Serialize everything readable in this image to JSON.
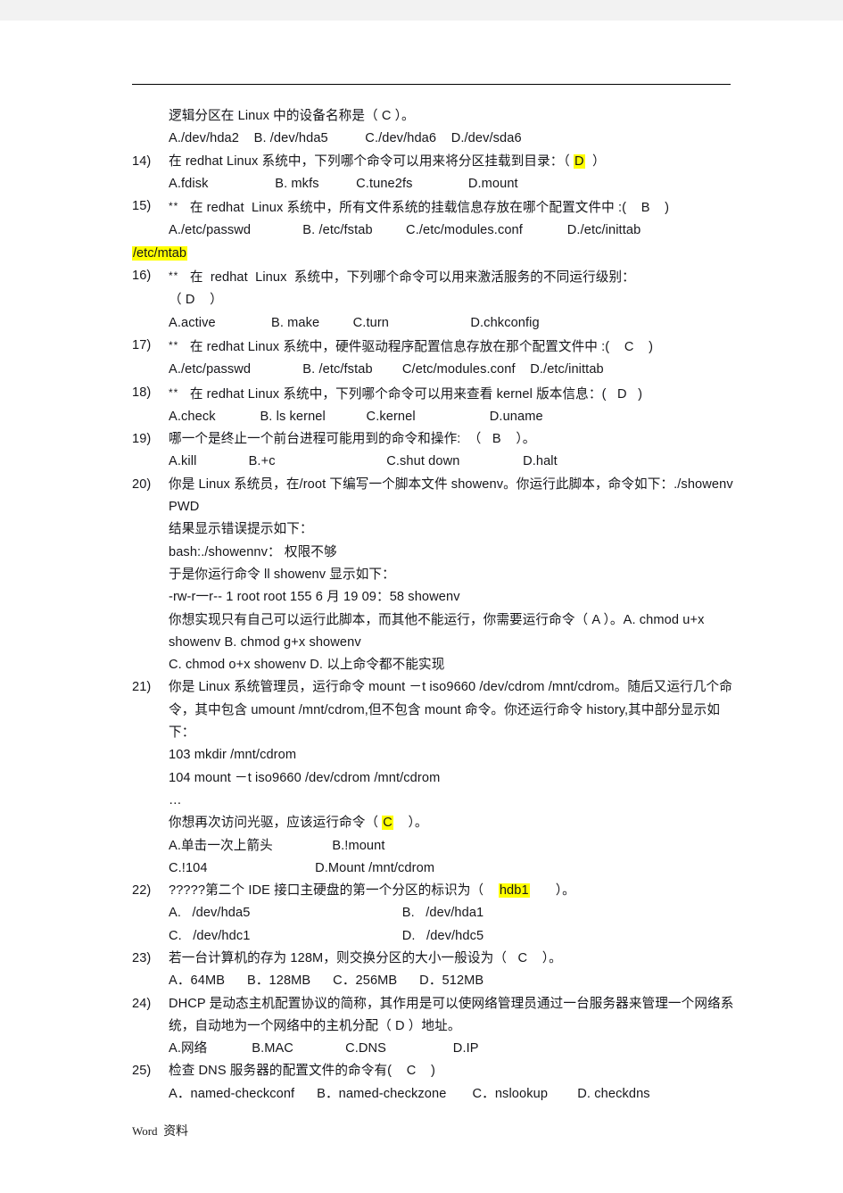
{
  "document": {
    "footer_latin": "Word",
    "footer_cn": "资料"
  },
  "questions": [
    {
      "number": "",
      "lines": [
        "逻辑分区在 Linux 中的设备名称是（ C ）。",
        "A./dev/hda2    B. /dev/hda5          C./dev/hda6    D./dev/sda6"
      ]
    },
    {
      "number": "14)",
      "stem_pre": "在 redhat Linux 系统中，下列哪个命令可以用来将分区挂载到目录：（ ",
      "stem_hl": "D",
      "stem_post": "  ）",
      "options": "A.fdisk                  B. mkfs          C.tune2fs               D.mount"
    },
    {
      "number": "15)",
      "stars": "**",
      "stem": "在 redhat  Linux 系统中，所有文件系统的挂载信息存放在哪个配置文件中 :(    B    )",
      "options": "A./etc/passwd              B. /etc/fstab         C./etc/modules.conf            D./etc/inittab",
      "flush_hl": "/etc/mtab"
    },
    {
      "number": "16)",
      "stars": "**",
      "stem_line1": "在  redhat  Linux  系统中，下列哪个命令可以用来激活服务的不同运行级别：",
      "stem_line2": "（ D    ）",
      "options": "A.active               B. make         C.turn                      D.chkconfig"
    },
    {
      "number": "17)",
      "stars": "**",
      "stem": "在 redhat Linux 系统中，硬件驱动程序配置信息存放在那个配置文件中 :(    C    )",
      "options": "A./etc/passwd              B. /etc/fstab        C/etc/modules.conf    D./etc/inittab"
    },
    {
      "number": "18)",
      "stars": "**",
      "stem": "在 redhat Linux 系统中，下列哪个命令可以用来查看 kernel 版本信息：(   D   )",
      "options": "A.check            B. ls kernel           C.kernel                    D.uname"
    },
    {
      "number": "19)",
      "stem": "哪一个是终止一个前台进程可能用到的命令和操作:  （   B    ）。",
      "options": "A.kill              B.+c                              C.shut down                 D.halt"
    },
    {
      "number": "20)",
      "lines": [
        "你是 Linux 系统员，在/root 下编写一个脚本文件 showenv。你运行此脚本，命令如下：./showenv PWD",
        "结果显示错误提示如下：",
        "bash:./showennv： 权限不够",
        "于是你运行命令 ll showenv 显示如下：",
        "-rw-r一r-- 1 root root 155 6 月 19 09：58 showenv",
        "你想实现只有自己可以运行此脚本，而其他不能运行，你需要运行命令（ A     ）。A. chmod u+x showenv B. chmod g+x showenv",
        "C. chmod o+x showenv D. 以上命令都不能实现"
      ]
    },
    {
      "number": "21)",
      "stem_wrapped": "你是 Linux 系统管理员，运行命令 mount －t iso9660 /dev/cdrom /mnt/cdrom。随后又运行几个命令，其中包含 umount /mnt/cdrom,但不包含 mount 命令。你还运行命令 history,其中部分显示如下：",
      "hist1": "103 mkdir /mnt/cdrom",
      "hist2": "104 mount －t iso9660 /dev/cdrom /mnt/cdrom",
      "hist3": "…",
      "ask_pre": "你想再次访问光驱，应该运行命令（ ",
      "ask_hl": "C",
      "ask_post": "    ）。",
      "optionA": "A.单击一次上箭头                B.!mount",
      "optionB": "C.!104                             D.Mount /mnt/cdrom"
    },
    {
      "number": "22)",
      "stem_pre": "?????第二个 IDE 接口主硬盘的第一个分区的标识为（    ",
      "stem_hl": "hdb1",
      "stem_post": "       ）。",
      "optionsA": "A.   /dev/hda5                                         B.   /dev/hda1",
      "optionsB": "C.   /dev/hdc1                                         D.   /dev/hdc5"
    },
    {
      "number": "23)",
      "stem": "若一台计算机的存为 128M，则交换分区的大小一般设为（   C    ）。",
      "options": "A．64MB      B．128MB      C．256MB      D．512MB"
    },
    {
      "number": "24)",
      "stem_wrapped": "DHCP 是动态主机配置协议的简称，其作用是可以使网络管理员通过一台服务器来管理一个网络系统，自动地为一个网络中的主机分配（   D   ）地址。",
      "options": "A.网络            B.MAC              C.DNS                  D.IP"
    },
    {
      "number": "25)",
      "stem": "检查 DNS 服务器的配置文件的命令有(    C    )",
      "options": "A．named-checkconf      B．named-checkzone       C．nslookup        D. checkdns"
    }
  ],
  "colors": {
    "highlight": "#ffff00",
    "text": "#16161a",
    "page_background": "#ffffff",
    "canvas_background": "#f2f2f2"
  }
}
